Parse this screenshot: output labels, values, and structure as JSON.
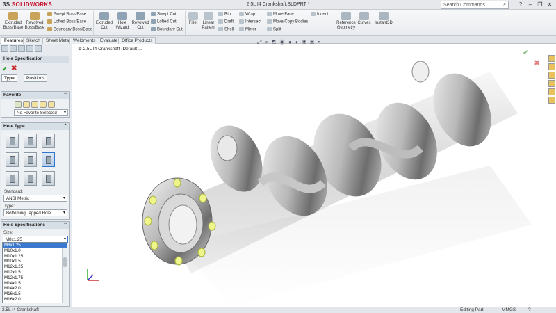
{
  "window": {
    "title": "2.5L I4 Crankshaft.SLDPRT *",
    "brand": "SOLIDWORKS",
    "brand_prefix": "3S"
  },
  "search": {
    "placeholder": "Search Commands"
  },
  "ribbon": {
    "large": [
      {
        "label1": "Extruded",
        "label2": "Boss/Base"
      },
      {
        "label1": "Revolved",
        "label2": "Boss/Base"
      },
      {
        "label1": "Extruded",
        "label2": "Cut"
      },
      {
        "label1": "Hole",
        "label2": "Wizard"
      },
      {
        "label1": "Revolved",
        "label2": "Cut"
      },
      {
        "label1": "Fillet",
        "label2": ""
      },
      {
        "label1": "Linear",
        "label2": "Pattern"
      },
      {
        "label1": "Reference",
        "label2": "Geometry"
      },
      {
        "label1": "Curves",
        "label2": ""
      },
      {
        "label1": "Instant3D",
        "label2": ""
      }
    ],
    "small": [
      "Swept Boss/Base",
      "Lofted Boss/Base",
      "Boundary Boss/Base",
      "Swept Cut",
      "Lofted Cut",
      "Boundary Cut",
      "Rib",
      "Draft",
      "Shell",
      "Wrap",
      "Intersect",
      "Mirror",
      "Move Face",
      "Move/Copy Bodies",
      "Split",
      "Indent"
    ]
  },
  "tabs": [
    "Features",
    "Sketch",
    "Sheet Metal",
    "Weldments",
    "Evaluate",
    "Office Products"
  ],
  "panel": {
    "title": "Hole Specification",
    "subtabs": [
      "Type",
      "Positions"
    ],
    "favorite": {
      "header": "Favorite",
      "value": "No Favorite Selected"
    },
    "hole_type": {
      "header": "Hole Type",
      "standard_label": "Standard:",
      "standard": "ANSI Metric",
      "type_label": "Type:",
      "type": "Bottoming Tapped Hole"
    },
    "spec": {
      "header": "Hole Specifications",
      "size_label": "Size:",
      "size": "M8x1.25",
      "options": [
        "M8x1.25",
        "M10x1.0",
        "M10x1.25",
        "M10x1.5",
        "M12x1.25",
        "M12x1.5",
        "M12x1.75",
        "M14x1.5",
        "M14x2.0",
        "M16x1.5",
        "M16x2.0"
      ]
    }
  },
  "tree": {
    "root": "2.5L I4 Crankshaft (Default)..."
  },
  "status": {
    "left": "2.5L I4 Crankshaft",
    "mode": "Editing Part",
    "units": "MMGS"
  },
  "colors": {
    "accent": "#3a78d0",
    "ok": "#2a9a2a",
    "cancel": "#c62828"
  }
}
